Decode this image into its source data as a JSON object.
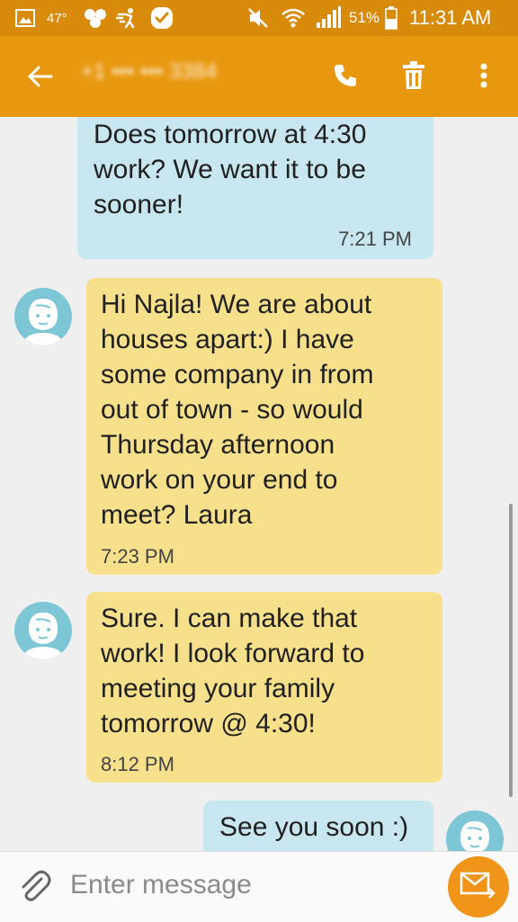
{
  "status_bar": {
    "temperature": "47°",
    "battery": "51%",
    "time": "11:31 AM"
  },
  "header": {
    "contact": "+1 ••• ••• 3384"
  },
  "messages": [
    {
      "direction": "outgoing",
      "text": "Does tomorrow at 4:30\nwork? We want it to be\nsooner!",
      "time": "7:21 PM"
    },
    {
      "direction": "incoming",
      "text": "Hi Najla!  We are about\nhouses apart:)   I have\nsome company in from\nout of town - so would\nThursday afternoon\nwork on your end to\nmeet?  Laura",
      "time": "7:23 PM"
    },
    {
      "direction": "incoming",
      "text": " Sure.  I can make that\nwork!  I look forward to\nmeeting your family\ntomorrow @ 4:30!",
      "time": "8:12 PM"
    },
    {
      "direction": "outgoing",
      "text": "See you soon :)",
      "time": ""
    }
  ],
  "composer": {
    "placeholder": "Enter message"
  },
  "colors": {
    "status_bar": "#d88a0a",
    "app_bar": "#e8980f",
    "outgoing_bubble": "#c8e6ef",
    "incoming_bubble": "#f6e08c",
    "avatar": "#7cc6d6",
    "send_button": "#f0941a"
  }
}
